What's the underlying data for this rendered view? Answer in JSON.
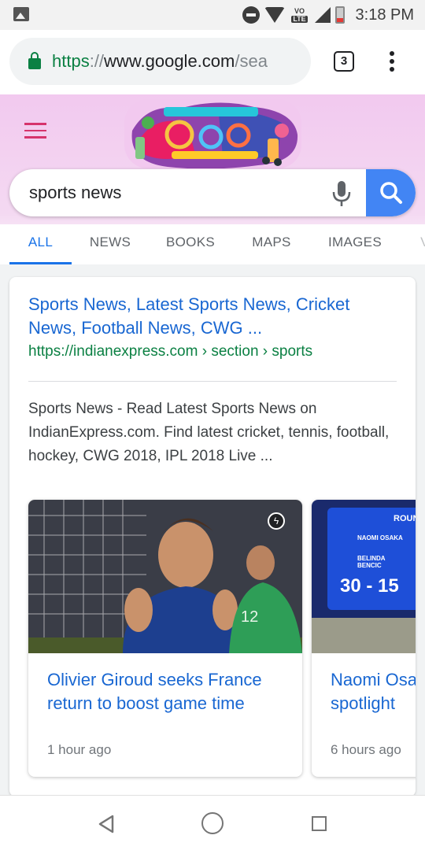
{
  "status_bar": {
    "time": "3:18 PM",
    "volte_top": "VO",
    "volte_bottom": "LTE",
    "icons": [
      "gallery-icon",
      "do-not-disturb-icon",
      "wifi-icon",
      "volte-icon",
      "signal-icon",
      "battery-icon"
    ]
  },
  "browser": {
    "url_scheme": "https",
    "url_separator": "://",
    "url_host": "www.google.com",
    "url_rest": "/sea",
    "tab_count": "3"
  },
  "google": {
    "search_query": "sports news",
    "tabs": [
      "ALL",
      "NEWS",
      "BOOKS",
      "MAPS",
      "IMAGES",
      "V"
    ],
    "active_tab": "ALL"
  },
  "result": {
    "title": "Sports News, Latest Sports News, Cricket News, Football News, CWG ...",
    "url": "https://indianexpress.com › section › sports",
    "snippet": "Sports News - Read Latest Sports News on IndianExpress.com. Find latest cricket, tennis, football, hockey, CWG 2018, IPL 2018 Live ..."
  },
  "news_cards": [
    {
      "title": "Olivier Giroud seeks France return to boost game time",
      "time": "1 hour ago",
      "amp": "ϟ"
    },
    {
      "title": "Naomi Osaka primed for big spotlight",
      "time": "6 hours ago",
      "scoreboard_label": "ROUN",
      "player1": "NAOMI OSAKA",
      "player2": "BELINDA BENCIC",
      "score": "30 - 15"
    }
  ],
  "colors": {
    "accent_blue": "#1a73e8",
    "link_blue": "#1967d2",
    "url_green": "#0b8043",
    "header_pink": "#f2c9ef",
    "hamburger_pink": "#d6336c",
    "search_button": "#4285f4"
  }
}
